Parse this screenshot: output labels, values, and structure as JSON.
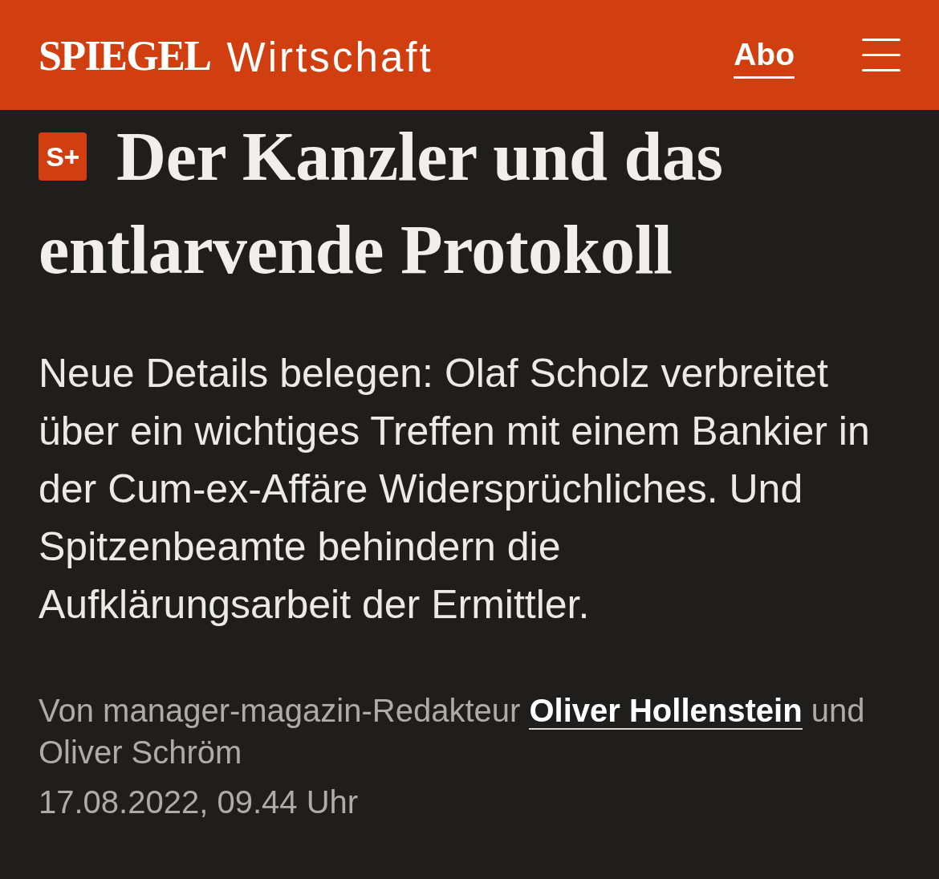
{
  "header": {
    "logo": "SPIEGEL",
    "section": "Wirtschaft",
    "subscribe_link": "Abo"
  },
  "article": {
    "badge": "S+",
    "headline_lines": [
      "Der Kanzler und das",
      "entlarvende Protokoll"
    ],
    "lede": "Neue Details belegen: Olaf Scholz verbreitet über ein wichtiges Treffen mit einem Bankier in der Cum-ex-Affäre Widersprüchliches. Und Spitzenbeamte behindern die Aufklärungsarbeit der Ermittler.",
    "byline": [
      {
        "kind": "text",
        "text": "Von manager-magazin-Redakteur"
      },
      {
        "kind": "link",
        "text": "Oliver Hollenstein"
      },
      {
        "kind": "text",
        "text": "und Oliver Schröm"
      }
    ],
    "date": "17.08.2022, 09.44 Uhr"
  }
}
